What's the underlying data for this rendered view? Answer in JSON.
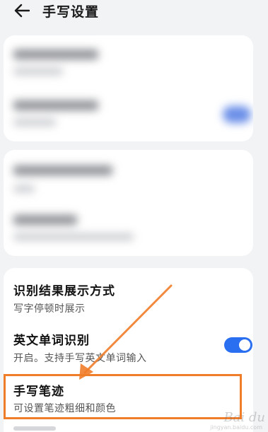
{
  "header": {
    "title": "手写设置",
    "back_icon": "arrow-left-icon"
  },
  "settings": [
    {
      "title": "识别结果展示方式",
      "subtitle": "写字停顿时展示"
    },
    {
      "title": "英文单词识别",
      "subtitle": "开启。支持手写英文单词输入",
      "toggle": true
    },
    {
      "title": "手写笔迹",
      "subtitle": "可设置笔迹粗细和颜色"
    }
  ],
  "colors": {
    "accent": "#2a6ff0",
    "highlight": "#f07d2a",
    "background": "#f1f3f5"
  },
  "watermark": {
    "text": "Bai du",
    "sub": "jingyan.baidu.com"
  }
}
